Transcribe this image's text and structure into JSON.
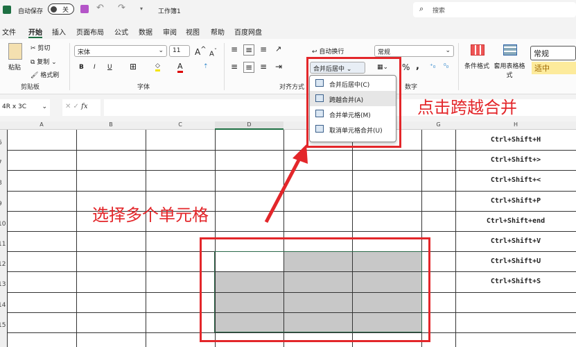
{
  "titlebar": {
    "autosave_label": "自动保存",
    "autosave_state": "关",
    "workbook": "工作簿1",
    "search_placeholder": "搜索"
  },
  "menu": [
    "文件",
    "开始",
    "插入",
    "页面布局",
    "公式",
    "数据",
    "审阅",
    "视图",
    "帮助",
    "百度网盘"
  ],
  "ribbon": {
    "clipboard": {
      "paste": "粘贴",
      "cut": "剪切",
      "copy": "复制",
      "format_painter": "格式刷",
      "group": "剪贴板"
    },
    "font": {
      "name": "宋体",
      "size": "11",
      "bold": "B",
      "italic": "I",
      "underline": "U",
      "group": "字体"
    },
    "alignment": {
      "wrap": "自动换行",
      "merge": "合并后居中",
      "group": "对齐方式"
    },
    "number": {
      "format": "常规",
      "percent": "%",
      "comma": ",",
      "group": "数字"
    },
    "styles": {
      "conditional": "条件格式",
      "table": "套用表格格式",
      "normal": "常规",
      "neutral": "适中"
    }
  },
  "merge_menu": [
    "合并后居中(C)",
    "跨越合并(A)",
    "合并单元格(M)",
    "取消单元格合并(U)"
  ],
  "formula_bar": {
    "name_box": "4R x 3C",
    "fx": "fx",
    "value": ""
  },
  "columns": [
    "A",
    "B",
    "C",
    "D",
    "",
    "",
    "G",
    "H"
  ],
  "rows": [
    "6",
    "7",
    "8",
    "9",
    "10",
    "11",
    "12",
    "13",
    "14",
    "15"
  ],
  "column_h_values": [
    "Ctrl+Shift+H",
    "Ctrl+Shift+>",
    "Ctrl+Shift+<",
    "Ctrl+Shift+P",
    "Ctrl+Shift+end",
    "Ctrl+Shift+V",
    "Ctrl+Shift+U",
    "Ctrl+Shift+S"
  ],
  "annotations": {
    "click_merge": "点击跨越合并",
    "select_cells": "选择多个单元格"
  },
  "colors": {
    "annotation": "#e3262a",
    "selection": "#c8c8c8",
    "excel_green": "#1d6f42"
  }
}
